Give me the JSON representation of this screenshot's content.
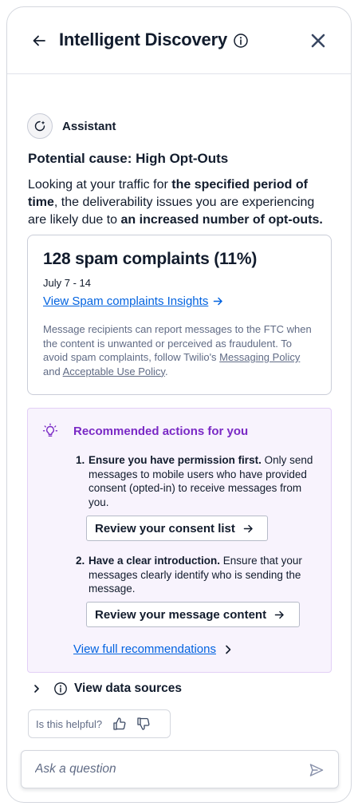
{
  "header": {
    "title": "Intelligent Discovery",
    "back_icon": "arrow-left-icon",
    "info_icon": "info-icon",
    "close_icon": "close-icon"
  },
  "assistant": {
    "label": "Assistant",
    "icon": "sparkle-icon"
  },
  "cause": {
    "title": "Potential cause: High Opt-Outs",
    "desc_pre": "Looking at your traffic for ",
    "desc_bold1": "the specified period of time",
    "desc_mid": ", the deliverability issues you are experiencing are likely due to ",
    "desc_bold2": "an increased number of opt-outs."
  },
  "card": {
    "metric": "128 spam complaints (11%)",
    "date": "July 7 - 14",
    "link": "View Spam complaints Insights",
    "fine_pre": "Message recipients can report messages to the FTC when the content is unwanted or perceived as fraudulent. To avoid spam complaints, follow Twilio's ",
    "fine_link1": "Messaging Policy",
    "fine_and": " and ",
    "fine_link2": "Acceptable Use Policy",
    "fine_end": "."
  },
  "recommendations": {
    "title": "Recommended actions for you",
    "steps": [
      {
        "num": "1.",
        "bold": "Ensure you have permission first.",
        "text": " Only send messages to mobile users who have provided consent (opted-in) to receive messages from you.",
        "button": "Review your consent list"
      },
      {
        "num": "2.",
        "bold": "Have a clear introduction.",
        "text": " Ensure that your messages clearly identify who is sending the message.",
        "button": "Review your message content"
      }
    ],
    "full_link": "View full recommendations"
  },
  "sources": {
    "label": "View data sources"
  },
  "feedback": {
    "question": "Is this helpful?"
  },
  "ask": {
    "placeholder": "Ask a question"
  },
  "colors": {
    "link": "#0263e0",
    "accent_purple": "#7a29c5",
    "recs_bg": "#f8f3fd",
    "text": "#121c2d",
    "muted": "#606b85"
  }
}
